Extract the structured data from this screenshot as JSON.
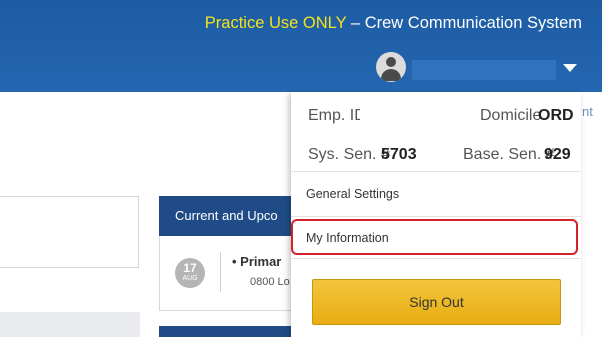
{
  "header": {
    "practice_text": "Practice Use ONLY",
    "separator": " – ",
    "system_name": "Crew Communication System"
  },
  "background": {
    "stray_text": "nt",
    "card": {
      "title": "Current and Upco",
      "event": {
        "day": "17",
        "month": "AUG",
        "title": "• Primar",
        "time": "0800 Lo"
      }
    }
  },
  "dropdown": {
    "emp_id_label": "Emp. ID",
    "domicile_label": "Domicile",
    "domicile_value": "ORD",
    "sys_sen_label": "Sys. Sen. #",
    "sys_sen_value": "5703",
    "base_sen_label": "Base. Sen. #",
    "base_sen_value": "929",
    "menu": [
      {
        "label": "General Settings"
      },
      {
        "label": "My Information"
      }
    ],
    "sign_out_label": "Sign Out"
  },
  "colors": {
    "header_blue": "#2466b0",
    "practice_yellow": "#f5e21b",
    "highlight_red": "#d2232a",
    "sign_out_gold": "#e8ae12"
  }
}
